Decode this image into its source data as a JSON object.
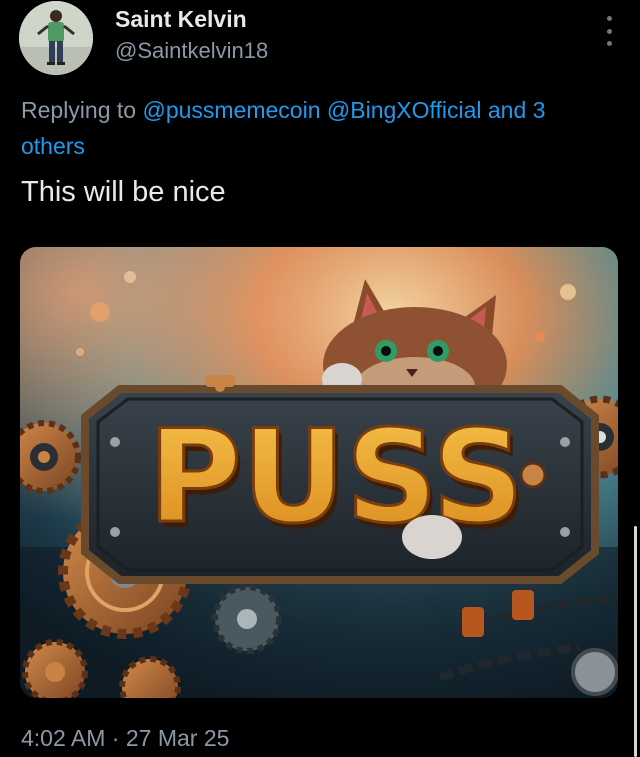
{
  "tweet": {
    "author": {
      "display_name": "Saint Kelvin",
      "handle": "@Saintkelvin18"
    },
    "more_icon": "vertical-ellipsis-icon",
    "reply": {
      "prefix": "Replying to",
      "mentions": [
        "@pussmemecoin",
        "@BingXOfficial"
      ],
      "joiner": "and 3",
      "overflow": "others"
    },
    "text": "This will be nice",
    "media": {
      "logo_text": "PUSS",
      "colors": {
        "logo_gold": "#e8a52c",
        "plate": "#2a3138",
        "sky_teal": "#4d8a93",
        "glow_orange": "#f09a52"
      }
    },
    "time": "4:02 AM",
    "separator": "·",
    "date": "27 Mar 25"
  },
  "theme": {
    "background": "#000000",
    "text": "#e7e9ea",
    "secondary": "#8b98a5",
    "link": "#1d9bf0"
  }
}
